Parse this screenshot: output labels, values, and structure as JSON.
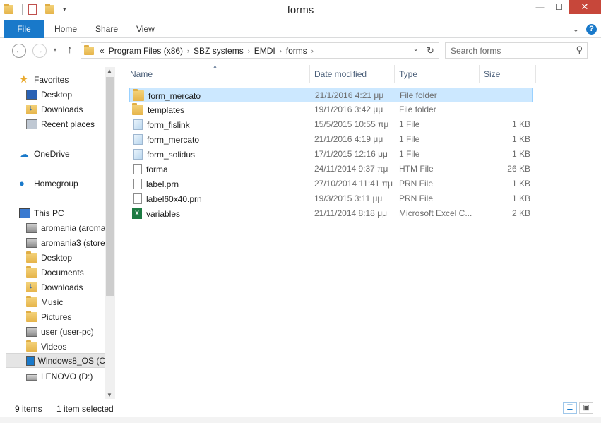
{
  "window": {
    "title": "forms"
  },
  "ribbon": {
    "tabs": [
      "File",
      "Home",
      "Share",
      "View"
    ]
  },
  "address": {
    "overflow": "«",
    "crumbs": [
      "Program Files (x86)",
      "SBZ systems",
      "EMDI",
      "forms"
    ]
  },
  "search": {
    "placeholder": "Search forms"
  },
  "nav": {
    "items": [
      {
        "label": "Favorites",
        "icon": "star-icon"
      },
      {
        "label": "Desktop",
        "icon": "desktop-icon"
      },
      {
        "label": "Downloads",
        "icon": "downloads-icon"
      },
      {
        "label": "Recent places",
        "icon": "recent-places-icon"
      },
      {
        "label": "OneDrive",
        "icon": "onedrive-icon"
      },
      {
        "label": "Homegroup",
        "icon": "homegroup-icon"
      },
      {
        "label": "This PC",
        "icon": "pc-icon"
      },
      {
        "label": "aromania (aroma",
        "icon": "network-drive-icon"
      },
      {
        "label": "aromania3 (store",
        "icon": "network-drive-icon"
      },
      {
        "label": "Desktop",
        "icon": "desktop-folder-icon"
      },
      {
        "label": "Documents",
        "icon": "documents-icon"
      },
      {
        "label": "Downloads",
        "icon": "downloads-icon"
      },
      {
        "label": "Music",
        "icon": "music-icon"
      },
      {
        "label": "Pictures",
        "icon": "pictures-icon"
      },
      {
        "label": "user (user-pc)",
        "icon": "network-drive-icon"
      },
      {
        "label": "Videos",
        "icon": "videos-icon"
      },
      {
        "label": "Windows8_OS (C",
        "icon": "windows-drive-icon"
      },
      {
        "label": "LENOVO (D:)",
        "icon": "drive-icon"
      }
    ]
  },
  "columns": [
    "Name",
    "Date modified",
    "Type",
    "Size"
  ],
  "files": [
    {
      "name": "form_mercato",
      "date": "21/1/2016 4:21 μμ",
      "type": "File folder",
      "size": "",
      "icon": "folder-icon",
      "selected": true
    },
    {
      "name": "templates",
      "date": "19/1/2016 3:42 μμ",
      "type": "File folder",
      "size": "",
      "icon": "folder-icon"
    },
    {
      "name": "form_fislink",
      "date": "15/5/2015 10:55 πμ",
      "type": "1 File",
      "size": "1 KB",
      "icon": "file-icon"
    },
    {
      "name": "form_mercato",
      "date": "21/1/2016 4:19 μμ",
      "type": "1 File",
      "size": "1 KB",
      "icon": "file-icon"
    },
    {
      "name": "form_solidus",
      "date": "17/1/2015 12:16 μμ",
      "type": "1 File",
      "size": "1 KB",
      "icon": "file-icon"
    },
    {
      "name": "forma",
      "date": "24/11/2014 9:37 πμ",
      "type": "HTM File",
      "size": "26 KB",
      "icon": "document-icon"
    },
    {
      "name": "label.prn",
      "date": "27/10/2014 11:41 πμ",
      "type": "PRN File",
      "size": "1 KB",
      "icon": "document-icon"
    },
    {
      "name": "label60x40.prn",
      "date": "19/3/2015 3:11 μμ",
      "type": "PRN File",
      "size": "1 KB",
      "icon": "document-icon"
    },
    {
      "name": "variables",
      "date": "21/11/2014 8:18 μμ",
      "type": "Microsoft Excel C...",
      "size": "2 KB",
      "icon": "excel-icon"
    }
  ],
  "status": {
    "count": "9 items",
    "selection": "1 item selected"
  },
  "colors": {
    "accent": "#1979ca",
    "selection": "#cce8ff",
    "close": "#c7473a"
  }
}
